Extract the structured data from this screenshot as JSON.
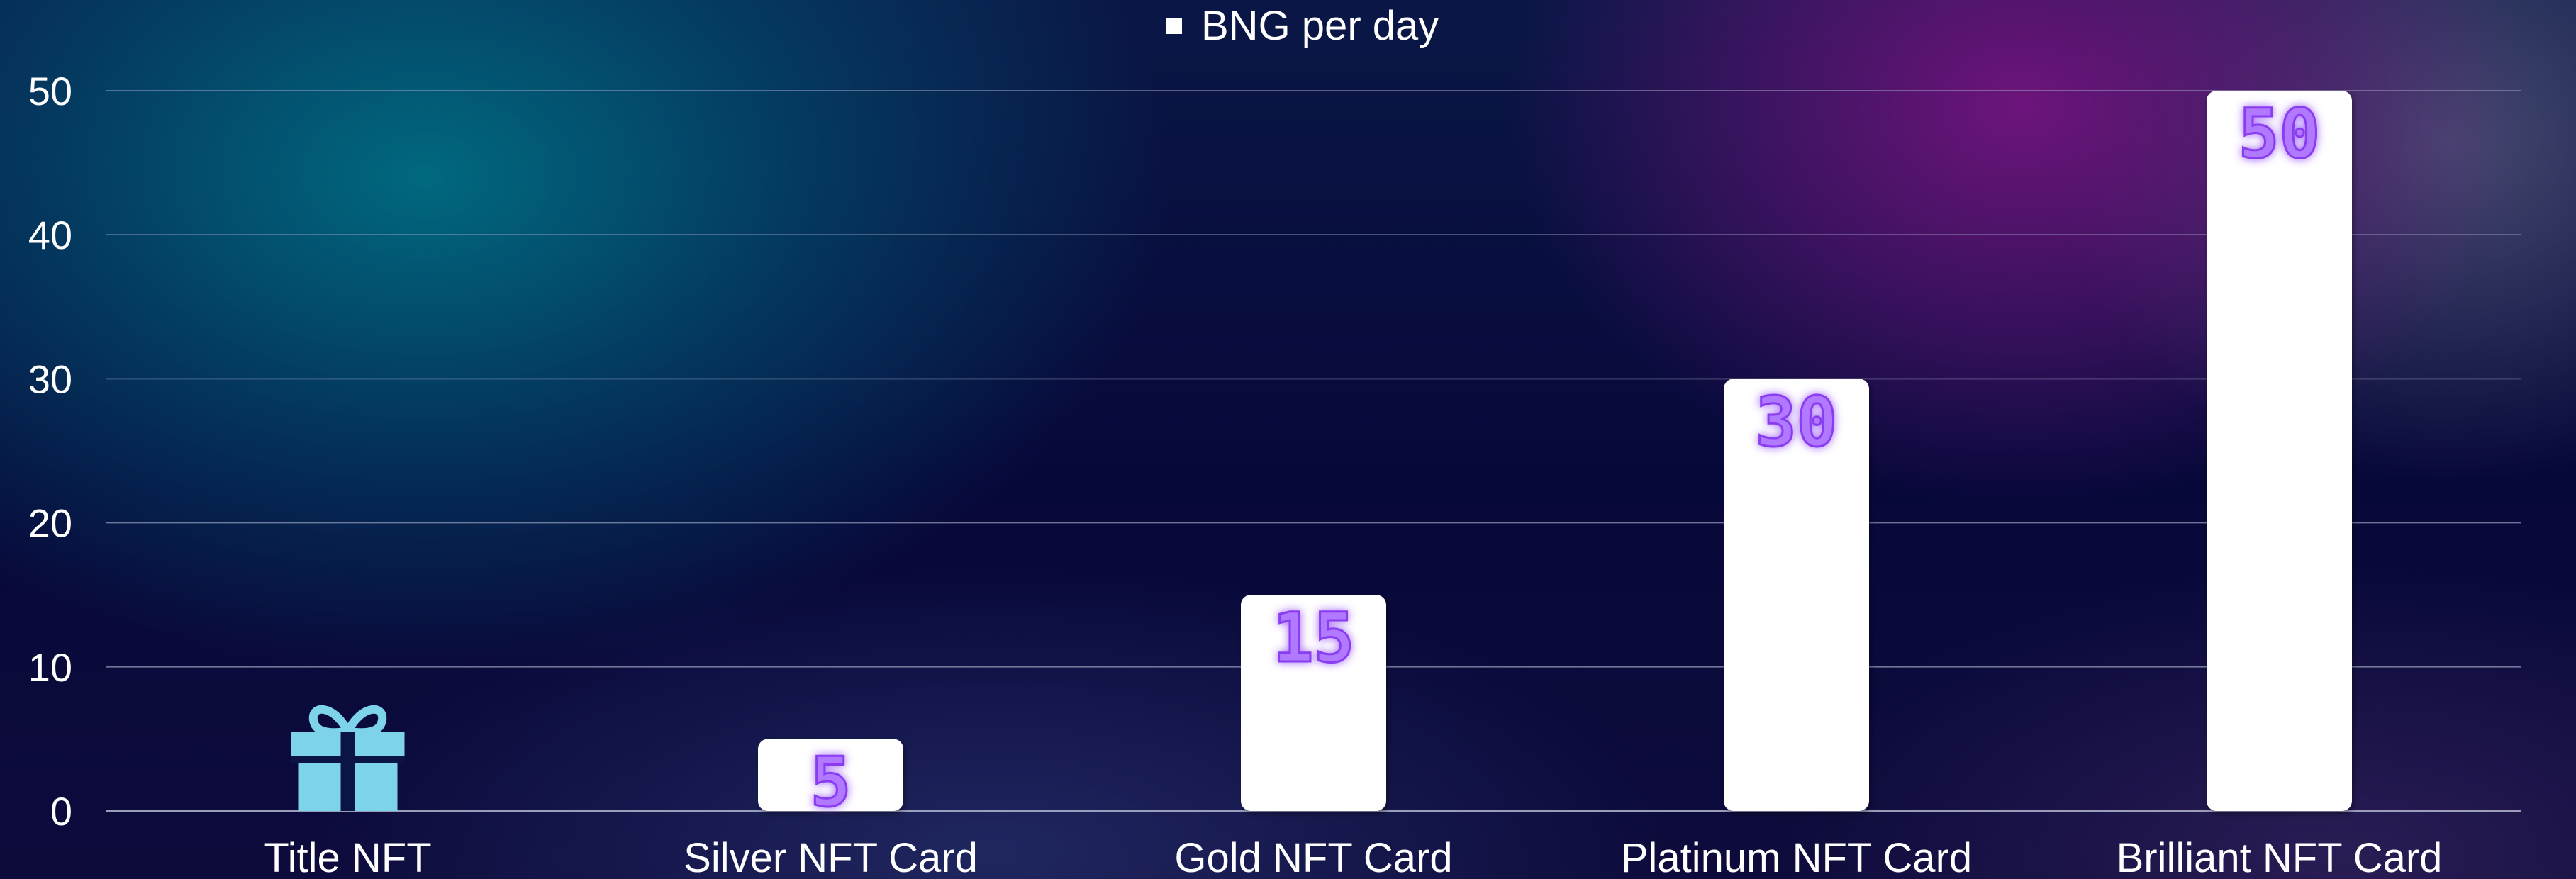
{
  "chart_data": {
    "type": "bar",
    "title": "",
    "xlabel": "",
    "ylabel": "",
    "categories": [
      "Title NFT",
      "Silver NFT Card",
      "Gold NFT Card",
      "Platinum NFT Card",
      "Brilliant NFT Card"
    ],
    "series": [
      {
        "name": "BNG per day",
        "values": [
          0,
          5,
          15,
          30,
          50
        ],
        "data_labels": [
          "",
          "5",
          "15",
          "30",
          "50"
        ]
      }
    ],
    "ylim": [
      0,
      50
    ],
    "yticks": [
      0,
      10,
      20,
      30,
      40,
      50
    ],
    "grid": true,
    "legend": "top-center",
    "first_category_marker": "gift-icon",
    "colors": {
      "bar": "#ffffff",
      "data_label": "#b179ff",
      "gift_icon": "#7dd3ea",
      "grid": "#a7adc8",
      "text": "#ffffff"
    }
  }
}
